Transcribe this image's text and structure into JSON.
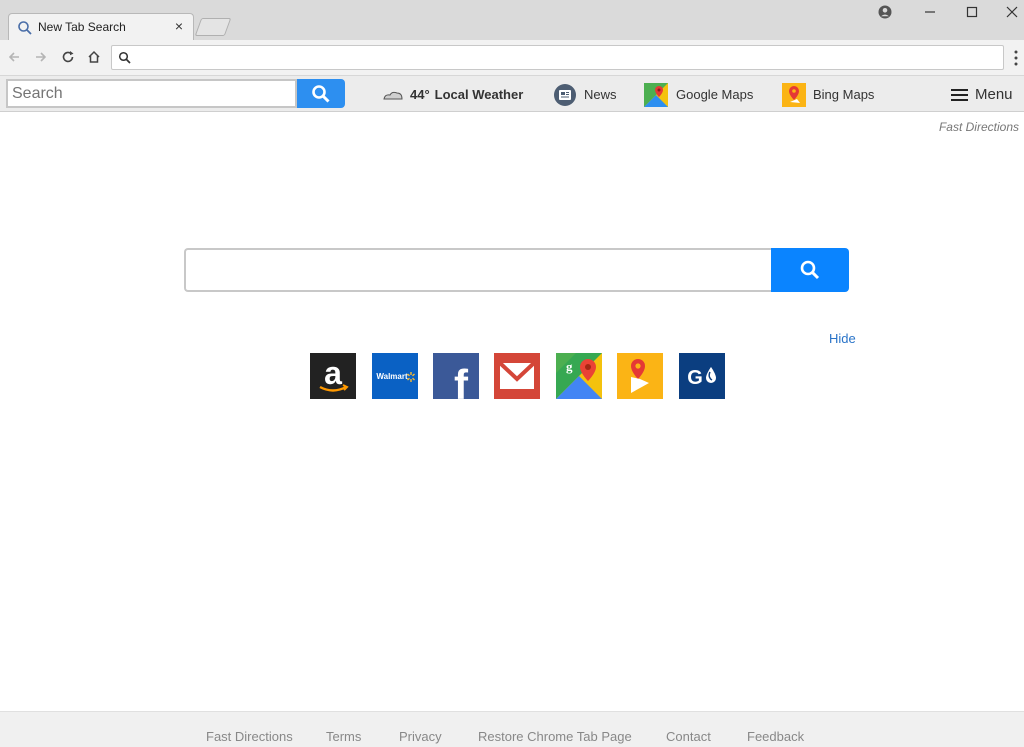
{
  "browser": {
    "tab_title": "New Tab Search",
    "tab_close": "×",
    "omnibox_value": ""
  },
  "toolbar": {
    "search_placeholder": "Search",
    "weather_temp": "44°",
    "weather_label": "Local Weather",
    "news_label": "News",
    "google_maps_label": "Google Maps",
    "bing_maps_label": "Bing Maps",
    "menu_label": "Menu"
  },
  "page": {
    "fast_directions_logo": "Fast Directions",
    "search_value": "",
    "hide_label": "Hide"
  },
  "tiles": [
    {
      "name": "amazon",
      "icon": "amazon-icon",
      "text": "a"
    },
    {
      "name": "walmart",
      "icon": "walmart-icon",
      "text": "Walmart"
    },
    {
      "name": "facebook",
      "icon": "facebook-icon",
      "text": "f"
    },
    {
      "name": "gmail",
      "icon": "gmail-icon"
    },
    {
      "name": "google-maps",
      "icon": "google-maps-icon"
    },
    {
      "name": "bing-maps",
      "icon": "bing-maps-icon"
    },
    {
      "name": "gasbuddy",
      "icon": "gasbuddy-icon",
      "text": "G"
    }
  ],
  "footer": {
    "links": [
      "Fast Directions",
      "Terms",
      "Privacy",
      "Restore Chrome Tab Page",
      "Contact",
      "Feedback"
    ]
  },
  "colors": {
    "accent_blue": "#0a84ff",
    "toolbar_search_blue": "#2d8ff0",
    "link_blue": "#2a74c8"
  }
}
